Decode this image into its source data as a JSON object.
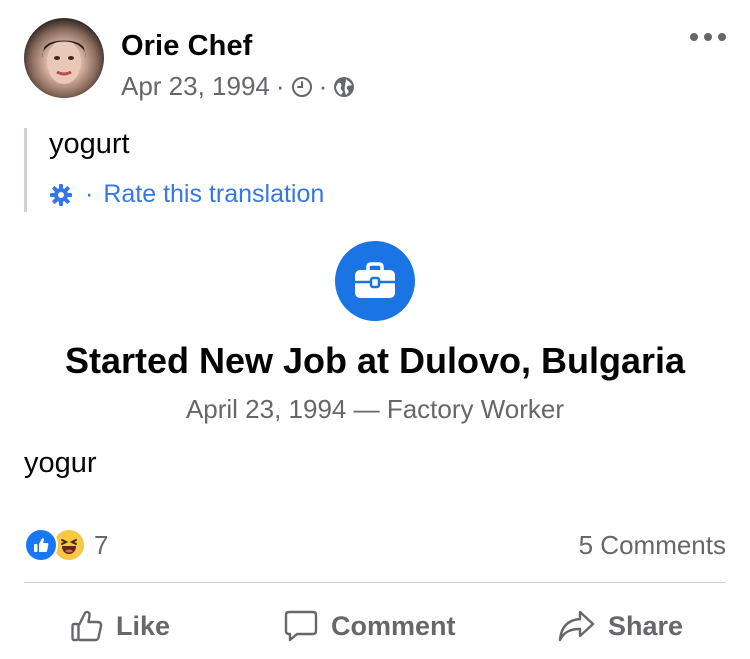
{
  "post": {
    "author": "Orie Chef",
    "date": "Apr 23, 1994",
    "separator": "·",
    "icons": {
      "clock": "clock-icon",
      "privacy": "globe-icon",
      "more": "more-horizontal-icon"
    }
  },
  "translation": {
    "text": "yogurt",
    "separator": "·",
    "rate_label": "Rate this translation",
    "icon": "gear-icon"
  },
  "life_event": {
    "icon": "briefcase-icon",
    "title": "Started New Job at Dulovo, Bulgaria",
    "subtitle": "April 23, 1994 — Factory Worker"
  },
  "body_text": "yogur",
  "reactions": {
    "types": [
      "like",
      "haha"
    ],
    "count": "7",
    "comments": "5 Comments"
  },
  "actions": {
    "like": "Like",
    "comment": "Comment",
    "share": "Share"
  },
  "colors": {
    "accent": "#1b74e4",
    "link": "#3578e5",
    "secondary_text": "#65676b",
    "primary_text": "#050505",
    "haha": "#f7c843"
  }
}
